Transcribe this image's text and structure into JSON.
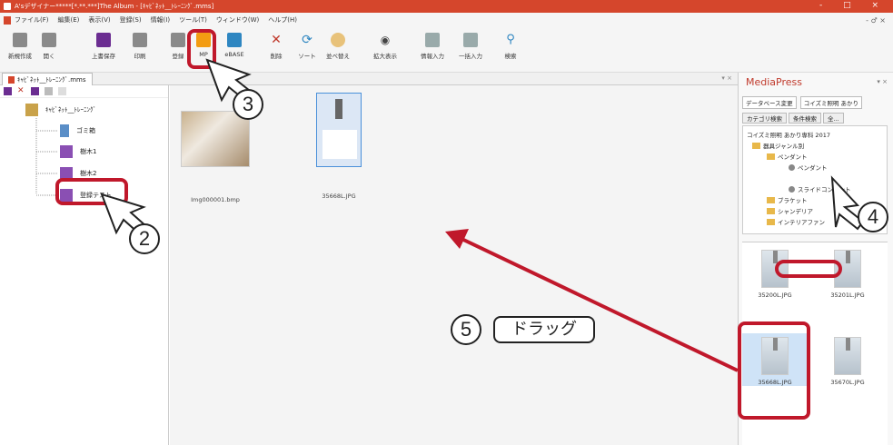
{
  "window": {
    "title": "A'sデザイナー*****[*.**.***]The Album - [ｷｬﾋﾞﾈｯﾄ__ﾄﾚｰﾆﾝｸﾞ.mms]",
    "controls": "- □ ×",
    "sub_controls": "- ♂ ×"
  },
  "menu": [
    "ファイル(F)",
    "編集(E)",
    "表示(V)",
    "登録(S)",
    "情報(I)",
    "ツール(T)",
    "ウィンドウ(W)",
    "ヘルプ(H)"
  ],
  "toolbar": [
    {
      "label": "新規作成",
      "icon": "new-file-icon",
      "color": "#7a7a7a"
    },
    {
      "label": "開く",
      "icon": "open-icon",
      "color": "#7a7a7a"
    },
    {
      "label": "上書保存",
      "icon": "save-icon",
      "color": "#6b2d91"
    },
    {
      "label": "印刷",
      "icon": "print-icon",
      "color": "#7a7a7a"
    },
    {
      "label": "登録",
      "icon": "register-icon",
      "color": "#7a7a7a"
    },
    {
      "label": "MP",
      "icon": "mediapress-icon",
      "color": "#f39c12"
    },
    {
      "label": "eBASE",
      "icon": "ebase-icon",
      "color": "#2e86c1"
    },
    {
      "label": "削除",
      "icon": "delete-icon",
      "color": "#c0392b"
    },
    {
      "label": "ソート",
      "icon": "sort-icon",
      "color": "#2e86c1"
    },
    {
      "label": "並べ替え",
      "icon": "rearrange-icon",
      "color": "#e0b060"
    },
    {
      "label": "拡大表示",
      "icon": "zoom-view-icon",
      "color": "#7a7a7a"
    },
    {
      "label": "情報入力",
      "icon": "info-input-icon",
      "color": "#7a7a7a"
    },
    {
      "label": "一括入力",
      "icon": "batch-input-icon",
      "color": "#7a7a7a"
    },
    {
      "label": "検索",
      "icon": "search-icon",
      "color": "#2e86c1"
    }
  ],
  "tab": {
    "label": "ｷｬﾋﾞﾈｯﾄ__ﾄﾚｰﾆﾝｸﾞ.mms",
    "close": "▾ ×"
  },
  "tree": {
    "root": "ｷｬﾋﾞﾈｯﾄ__ﾄﾚｰﾆﾝｸﾞ",
    "children": [
      "ゴミ箱",
      "樹木1",
      "樹木2",
      "登録テスト"
    ]
  },
  "content": {
    "thumbnails": [
      {
        "caption": "Img000001.bmp"
      },
      {
        "caption": "35668L.JPG"
      }
    ]
  },
  "media_press": {
    "title": "MediaPress",
    "controls": "▾ ×",
    "db_change": "データベース変更",
    "db_name": "コイズミ照明 あかり",
    "tabs": [
      "カテゴリ検索",
      "条件検索",
      "全..."
    ],
    "tree": [
      "コイズミ照明 あかり専科 2017",
      "器具ジャンル別",
      "ペンダント",
      "ペンダント",
      "スライドコンセント",
      "ブラケット",
      "シャンデリア",
      "インテリアファン"
    ],
    "results": [
      "35200L.JPG",
      "35201L.JPG",
      "35668L.JPG",
      "35670L.JPG"
    ]
  },
  "annotations": {
    "step2": "2",
    "step3": "3",
    "step4": "4",
    "step5": "5",
    "drag": "ドラッグ"
  }
}
